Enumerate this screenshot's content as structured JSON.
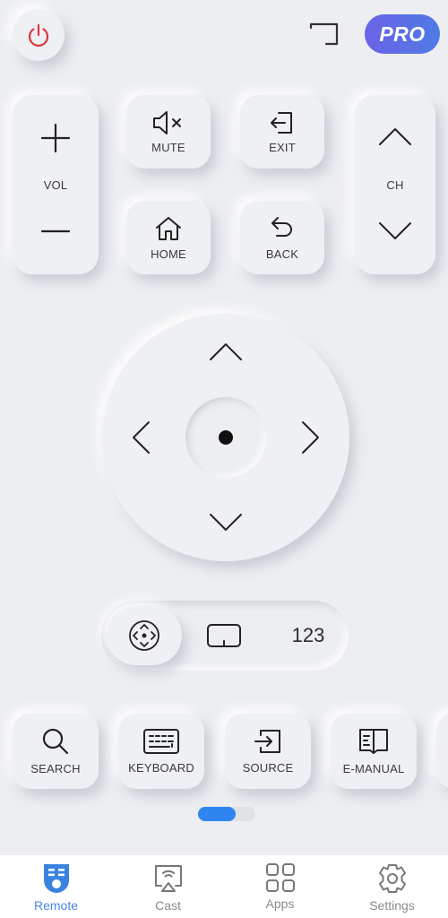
{
  "topbar": {
    "power_icon": "power-icon",
    "screen_icon": "screen-mirror-icon",
    "pro_label": "PRO"
  },
  "volume": {
    "label": "VOL",
    "up_icon": "plus-icon",
    "down_icon": "minus-icon"
  },
  "channel": {
    "label": "CH",
    "up_icon": "chevron-up-icon",
    "down_icon": "chevron-down-icon"
  },
  "buttons": {
    "mute": {
      "label": "MUTE",
      "icon": "mute-icon"
    },
    "exit": {
      "label": "EXIT",
      "icon": "exit-icon"
    },
    "home": {
      "label": "HOME",
      "icon": "home-icon"
    },
    "back": {
      "label": "BACK",
      "icon": "back-icon"
    }
  },
  "dpad": {
    "ok_icon": "ok-dot-icon",
    "arrows": [
      "up",
      "down",
      "left",
      "right"
    ]
  },
  "mode_switch": {
    "options": [
      {
        "name": "dpad",
        "icon": "dpad-icon",
        "active": true
      },
      {
        "name": "touchpad",
        "icon": "touchpad-icon",
        "active": false
      },
      {
        "name": "numpad",
        "label": "123",
        "active": false
      }
    ]
  },
  "function_row": [
    {
      "label": "SEARCH",
      "icon": "search-icon"
    },
    {
      "label": "KEYBOARD",
      "icon": "keyboard-icon"
    },
    {
      "label": "SOURCE",
      "icon": "source-icon"
    },
    {
      "label": "E-MANUAL",
      "icon": "book-icon"
    }
  ],
  "pager": {
    "page": 1,
    "pages": 2,
    "active_fraction": 0.66
  },
  "tabbar": {
    "active": "Remote",
    "items": [
      {
        "label": "Remote",
        "icon": "remote-icon"
      },
      {
        "label": "Cast",
        "icon": "cast-icon"
      },
      {
        "label": "Apps",
        "icon": "apps-grid-icon"
      },
      {
        "label": "Settings",
        "icon": "gear-icon"
      }
    ]
  },
  "colors": {
    "background": "#eceef1",
    "accent": "#2f86f0",
    "power": "#d9363e",
    "pro_gradient_start": "#6a63e6",
    "pro_gradient_end": "#4f7ae6",
    "tab_active": "#4a86e8",
    "tab_inactive": "#8a8a8a"
  }
}
